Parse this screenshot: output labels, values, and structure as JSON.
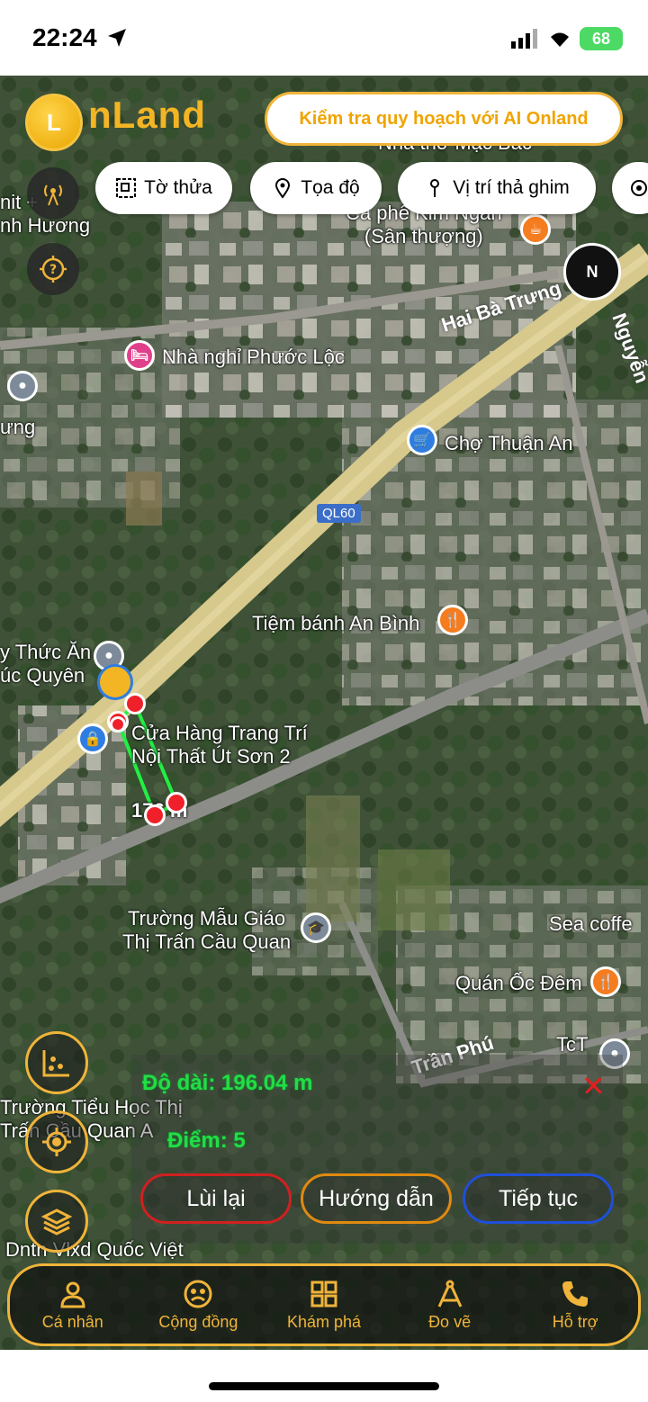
{
  "status": {
    "time": "22:24",
    "battery": "68"
  },
  "header": {
    "logo_text": "nLand",
    "ai_check": "Kiểm tra quy hoạch với AI Onland"
  },
  "chips": [
    {
      "label": "Tờ thửa",
      "icon": "parcel-icon"
    },
    {
      "label": "Tọa độ",
      "icon": "location-pin-icon"
    },
    {
      "label": "Vị trí thả ghim",
      "icon": "pin-drop-icon"
    }
  ],
  "compass": {
    "label": "N"
  },
  "map_labels": {
    "cafe": "Cà phê Kim Ngân\n(Sân thượng)",
    "nha_tho": "Nhà thờ Mặc Bắc",
    "hai_ba_trung": "Hai Bà Trưng",
    "nguyen": "Nguyễn",
    "nha_nghi": "Nhà nghỉ Phước Lộc",
    "cho_thuan_an": "Chợ Thuận An",
    "ql60": "QL60",
    "tiem_banh": "Tiệm bánh An Bình",
    "thuc_an": "y Thức Ăn\núc Quyên",
    "cua_hang": "Cửa Hàng Trang Trí\nNội Thất Út Sơn 2",
    "measure_point": "176 m",
    "truong_mau_giao": "Trường Mẫu Giáo\nThị Trấn Cầu Quan",
    "sea_coffee": "Sea coffe",
    "quan_oc": "Quán Ốc Đêm",
    "tran_phu": "Trần Phú",
    "tct": "TcT",
    "truong_tieu_hoc": "Trường Tiểu Học Thị\nTrấn Cầu Quan A",
    "dntn": "Dntn Vlxd Quốc Việt",
    "left_top": "nit +\nnh Hương",
    "left_mid": "ưng"
  },
  "measure": {
    "length": "Độ dài: 196.04 m",
    "points": "Điểm: 5",
    "close": "✕"
  },
  "actions": {
    "undo": "Lùi lại",
    "guide": "Hướng dẫn",
    "continue": "Tiếp tục"
  },
  "nav": [
    {
      "label": "Cá nhân",
      "icon": "person-icon"
    },
    {
      "label": "Cộng đồng",
      "icon": "community-icon"
    },
    {
      "label": "Khám phá",
      "icon": "grid-icon"
    },
    {
      "label": "Đo vẽ",
      "icon": "compass-draw-icon"
    },
    {
      "label": "Hỗ trợ",
      "icon": "phone-icon"
    }
  ],
  "colors": {
    "accent": "#f0b43a",
    "measure": "#22dd44",
    "undo": "#d02020",
    "guide": "#e08a10",
    "continue": "#1f4fd8"
  }
}
